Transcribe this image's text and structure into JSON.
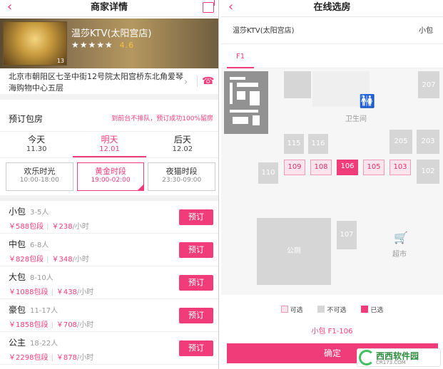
{
  "left": {
    "nav": {
      "title": "商家详情",
      "back_icon": "back-arrow-icon",
      "share_icon": "share-icon"
    },
    "store": {
      "name": "温莎KTV(太阳宫店)",
      "stars": "★★★★★",
      "score": "4.6",
      "photo_count": "13"
    },
    "address": {
      "text": "北京市朝阳区七圣中街12号院太阳宫桥东北角爱琴海购物中心五层"
    },
    "booking": {
      "title": "预订包房",
      "slogan": "到前台不排队，预订成功100%留房"
    },
    "days": [
      {
        "day": "今天",
        "date": "11.30"
      },
      {
        "day": "明天",
        "date": "12.01"
      },
      {
        "day": "后天",
        "date": "12.02"
      }
    ],
    "slots": [
      {
        "name": "欢乐时光",
        "hours": "10:00-18:00"
      },
      {
        "name": "黄金时段",
        "hours": "19:00-02:00"
      },
      {
        "name": "夜猫时段",
        "hours": "23:30-09:00"
      }
    ],
    "rooms": [
      {
        "name": "小包",
        "cap": "3-5人",
        "pkg": "￥588包段",
        "hour": "￥238",
        "unit": "/小时",
        "btn": "预订"
      },
      {
        "name": "中包",
        "cap": "6-8人",
        "pkg": "￥828包段",
        "hour": "￥348",
        "unit": "/小时",
        "btn": "预订"
      },
      {
        "name": "大包",
        "cap": "8-10人",
        "pkg": "￥1088包段",
        "hour": "￥438",
        "unit": "/小时",
        "btn": "预订"
      },
      {
        "name": "豪包",
        "cap": "11-17人",
        "pkg": "￥1858包段",
        "hour": "￥708",
        "unit": "/小时",
        "btn": "预订"
      },
      {
        "name": "公主",
        "cap": "18-22人",
        "pkg": "￥2298包段",
        "hour": "￥878",
        "unit": "/小时",
        "btn": "预订"
      }
    ]
  },
  "right": {
    "nav": {
      "title": "在线选房",
      "back_icon": "back-arrow-icon"
    },
    "store_name": "温莎KTV(太阳宫店)",
    "room_size": "小包",
    "floor": "F1",
    "map": {
      "restroom": "卫生间",
      "market": "超市",
      "park": "公厕",
      "room_107": "107",
      "rooms_row": [
        {
          "id": "109",
          "state": "avail"
        },
        {
          "id": "108",
          "state": "avail"
        },
        {
          "id": "106",
          "state": "sel"
        },
        {
          "id": "105",
          "state": "avail"
        },
        {
          "id": "103",
          "state": "avail"
        }
      ],
      "grey_blocks": [
        "115",
        "116",
        "205",
        "203",
        "110",
        "102",
        "207"
      ]
    },
    "legend": {
      "available": "可选",
      "unavailable": "不可选",
      "selected": "已选"
    },
    "selection": "小包 F1-106",
    "confirm": "确定"
  },
  "watermark": {
    "name": "西西软件园",
    "url": "CR173.COM"
  },
  "colors": {
    "accent": "#f03c78"
  }
}
